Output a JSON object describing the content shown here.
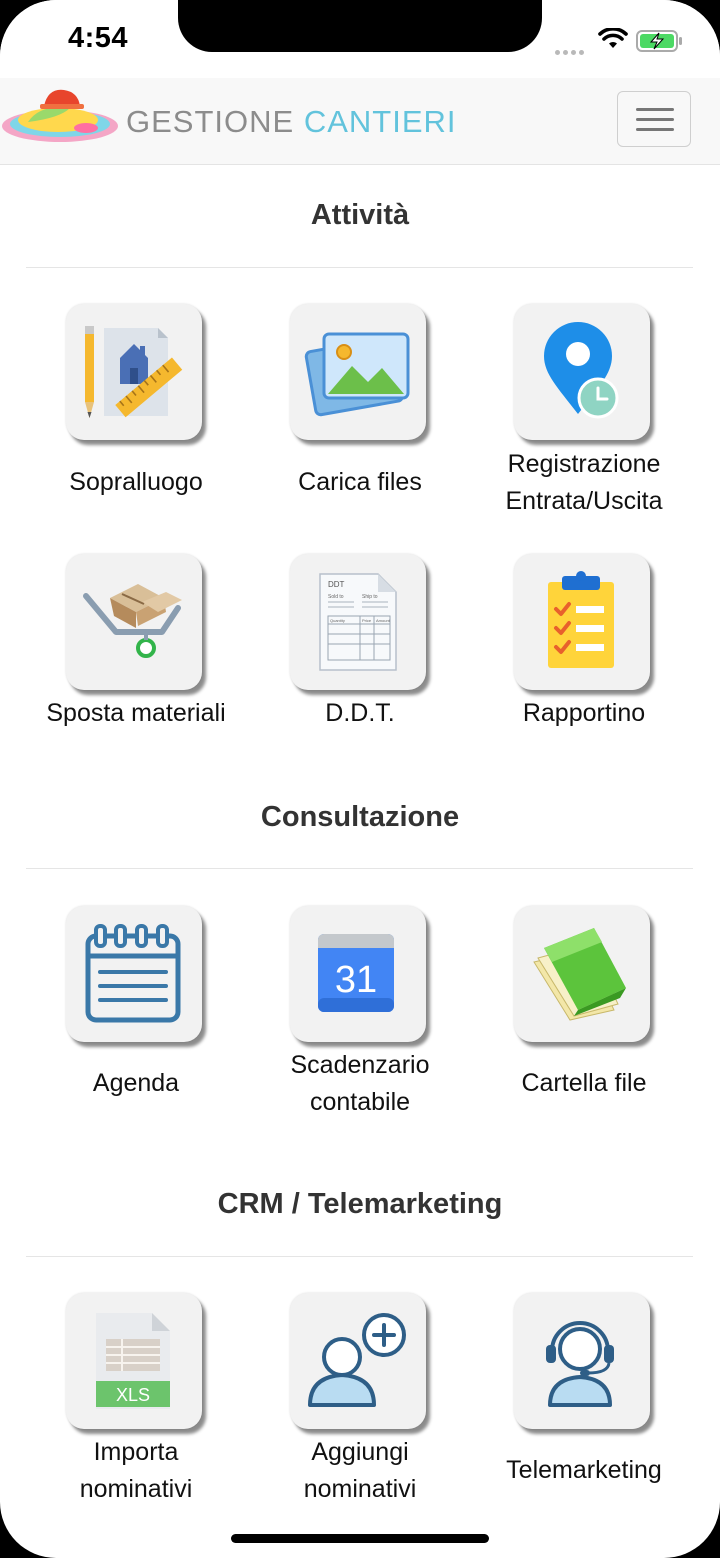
{
  "status_bar": {
    "time": "4:54"
  },
  "header": {
    "brand_part1": "GESTIONE",
    "brand_part2": "CANTIERI"
  },
  "colors": {
    "brand_gray": "#8c8c8c",
    "brand_cyan": "#62c3dc",
    "tile_bg": "#f2f2f2"
  },
  "sections": [
    {
      "title": "Attività",
      "items": [
        {
          "label": "Sopralluogo",
          "icon": "blueprint-pencil-icon"
        },
        {
          "label": "Carica files",
          "icon": "image-upload-icon"
        },
        {
          "label_lines": [
            "Registrazione",
            "Entrata/Uscita"
          ],
          "icon": "location-clock-icon"
        },
        {
          "label": "Sposta materiali",
          "icon": "cart-boxes-icon"
        },
        {
          "label": "D.D.T.",
          "icon": "document-ddt-icon",
          "icon_text": {
            "title": "DDT",
            "sold_to": "Sold to",
            "ship_to": "Ship to",
            "quantity": "Quantity",
            "price": "Price",
            "amount": "Amount"
          }
        },
        {
          "label": "Rapportino",
          "icon": "clipboard-checklist-icon"
        }
      ]
    },
    {
      "title": "Consultazione",
      "items": [
        {
          "label": "Agenda",
          "icon": "agenda-calendar-icon"
        },
        {
          "label_lines": [
            "Scadenzario",
            "contabile"
          ],
          "icon": "calendar-31-icon",
          "icon_text": "31"
        },
        {
          "label": "Cartella file",
          "icon": "green-folder-icon"
        }
      ]
    },
    {
      "title": "CRM / Telemarketing",
      "items": [
        {
          "label_lines": [
            "Importa",
            "nominativi"
          ],
          "icon": "xls-file-icon",
          "icon_text": "XLS"
        },
        {
          "label_lines": [
            "Aggiungi",
            "nominativi"
          ],
          "icon": "add-user-icon"
        },
        {
          "label": "Telemarketing",
          "icon": "headset-operator-icon"
        }
      ]
    }
  ]
}
